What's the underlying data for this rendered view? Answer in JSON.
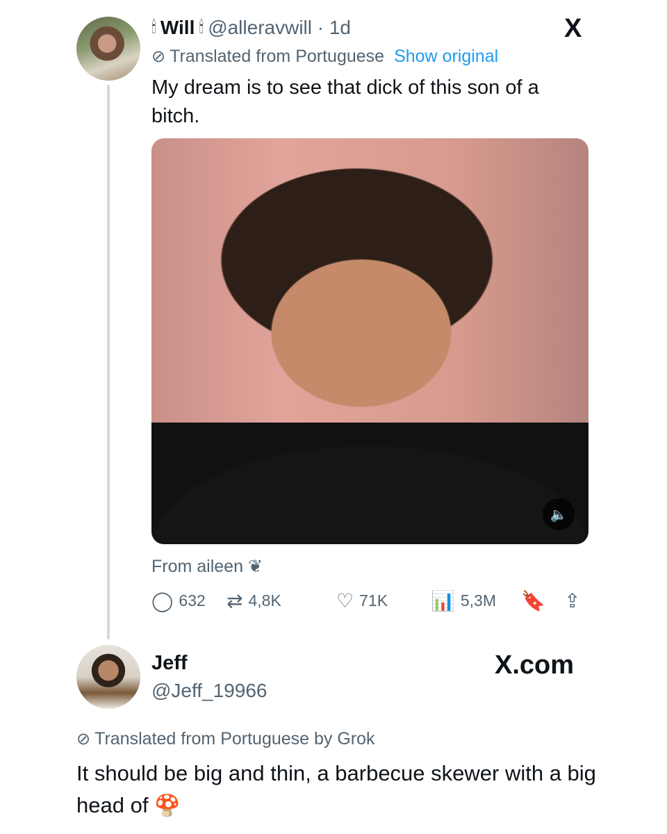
{
  "tweet": {
    "decor_emoji": "🕯",
    "display_name": "Will",
    "handle_time": "@alleravwill · 1d",
    "close_label": "X",
    "translated_label": "Translated from Portuguese",
    "show_original": "Show original",
    "text": "My dream is to see that dick of this son of a bitch.",
    "media_source": "From aileen",
    "media_source_emoji": "❦",
    "actions": {
      "replies": "632",
      "reposts": "4,8K",
      "likes": "71K",
      "views": "5,3M"
    }
  },
  "reply": {
    "display_name": "Jeff",
    "handle": "@Jeff_19966",
    "watermark": "X.com",
    "translated_label": "Translated from Portuguese by Grok",
    "text": "It should be big and thin, a barbecue skewer with a big head of",
    "emoji": "🍄"
  },
  "icons": [
    "globe-slash-icon",
    "reply-icon",
    "retweet-icon",
    "like-icon",
    "views-icon",
    "bookmark-icon",
    "share-icon",
    "volume-icon"
  ]
}
